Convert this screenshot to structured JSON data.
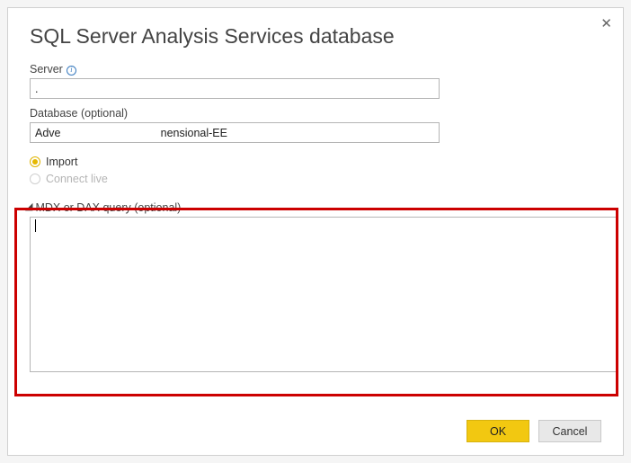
{
  "dialog": {
    "title": "SQL Server Analysis Services database",
    "close_glyph": "✕"
  },
  "server": {
    "label": "Server",
    "info_glyph": "i",
    "value": "."
  },
  "database": {
    "label": "Database (optional)",
    "value": "Adve                                nensional-EE"
  },
  "mode": {
    "import_label": "Import",
    "connect_live_label": "Connect live",
    "selected": "import"
  },
  "query": {
    "expander_caret": "◢",
    "label": "MDX or DAX query (optional)",
    "value": ""
  },
  "buttons": {
    "ok": "OK",
    "cancel": "Cancel"
  }
}
